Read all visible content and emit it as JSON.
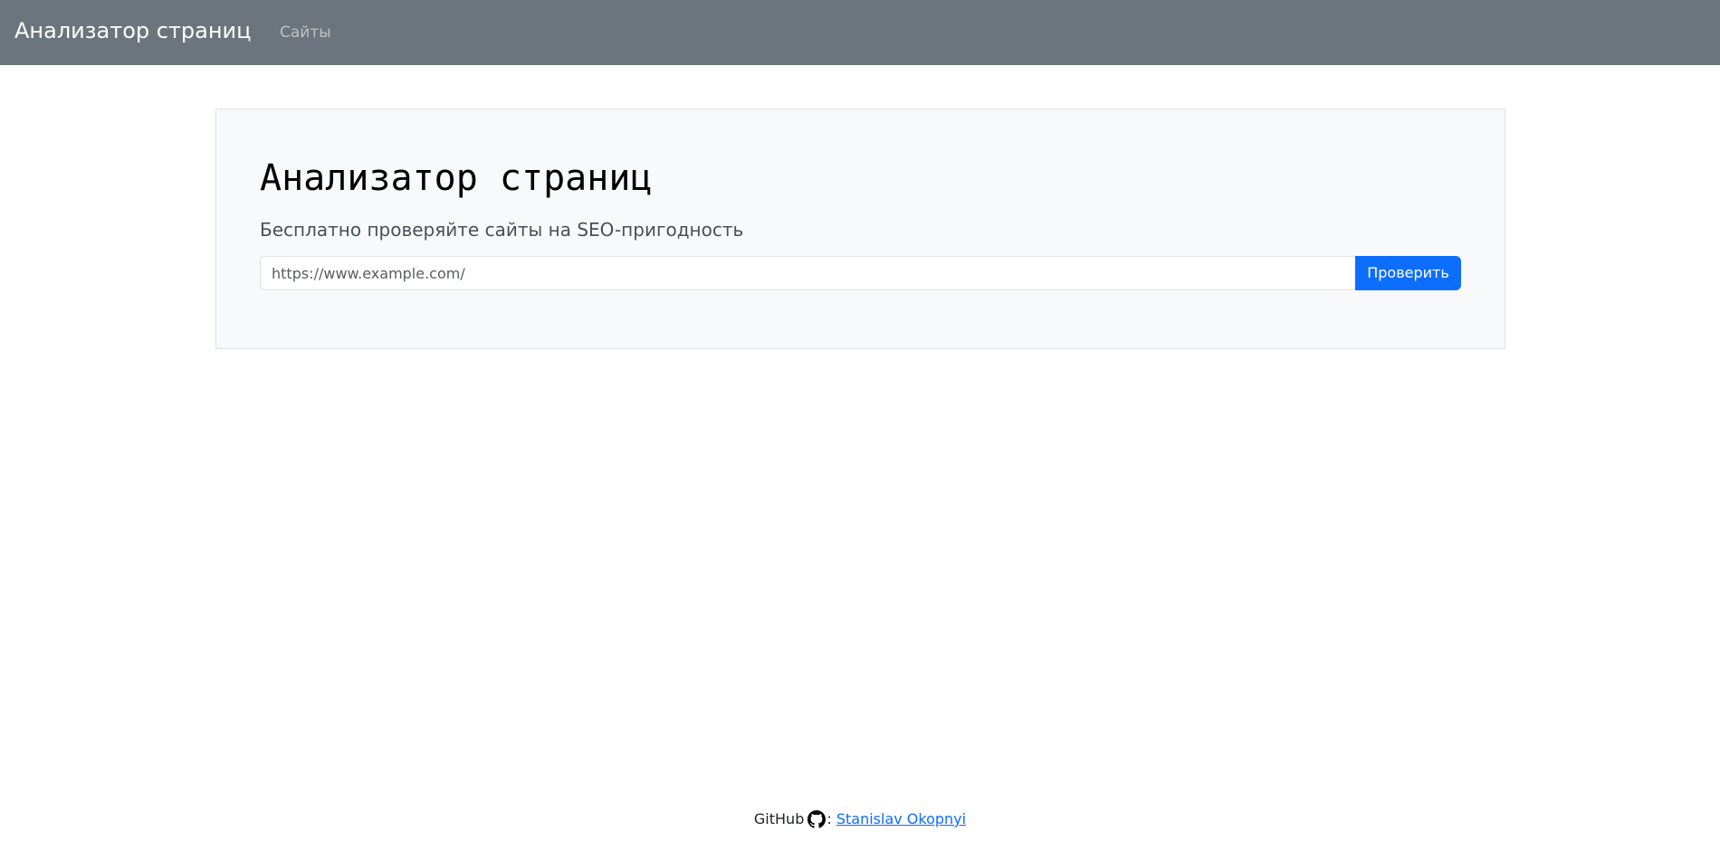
{
  "navbar": {
    "brand": "Анализатор страниц",
    "links": [
      {
        "label": "Сайты"
      }
    ]
  },
  "hero": {
    "title": "Анализатор страниц",
    "lead": "Бесплатно проверяйте сайты на SEO-пригодность",
    "url_input": {
      "placeholder": "https://www.example.com/",
      "value": ""
    },
    "submit_label": "Проверить"
  },
  "footer": {
    "prefix": "GitHub",
    "icon": "github-icon",
    "separator": ":",
    "author_link": "Stanislav Okopnyi"
  },
  "colors": {
    "navbar_bg": "#6c757d",
    "hero_bg": "#f8f9fa",
    "primary": "#0d6efd"
  }
}
